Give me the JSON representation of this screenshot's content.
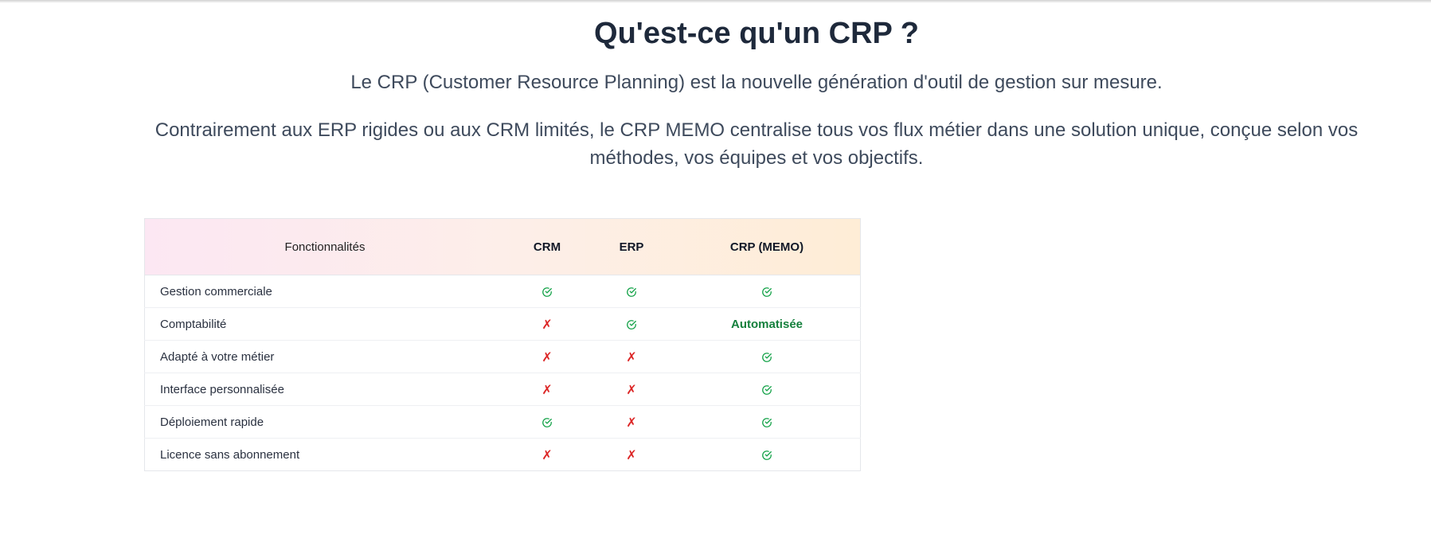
{
  "section": {
    "title": "Qu'est-ce qu'un CRP ?",
    "intro": "Le CRP (Customer Resource Planning) est la nouvelle génération d'outil de gestion sur mesure.",
    "description": "Contrairement aux ERP rigides ou aux CRM limités, le CRP MEMO centralise tous vos flux métier dans une solution unique, conçue selon vos méthodes, vos équipes et vos objectifs."
  },
  "table": {
    "headers": [
      "Fonctionnalités",
      "CRM",
      "ERP",
      "CRP (MEMO)"
    ],
    "rows": [
      {
        "feature": "Gestion commerciale",
        "crm": "check",
        "erp": "check",
        "crp": "check"
      },
      {
        "feature": "Comptabilité",
        "crm": "cross",
        "erp": "check",
        "crp": "Automatisée"
      },
      {
        "feature": "Adapté à votre métier",
        "crm": "cross",
        "erp": "cross",
        "crp": "check"
      },
      {
        "feature": "Interface personnalisée",
        "crm": "cross",
        "erp": "cross",
        "crp": "check"
      },
      {
        "feature": "Déploiement rapide",
        "crm": "check",
        "erp": "cross",
        "crp": "check"
      },
      {
        "feature": "Licence sans abonnement",
        "crm": "cross",
        "erp": "cross",
        "crp": "check"
      }
    ],
    "cross_glyph": "✗"
  },
  "colors": {
    "check": "#16a34a",
    "cross": "#dc2626",
    "header_gradient": [
      "#fce7f3",
      "#fdeee9",
      "#feedd6"
    ]
  },
  "icons": {
    "check": "check-circle-icon",
    "cross": "cross-icon"
  }
}
